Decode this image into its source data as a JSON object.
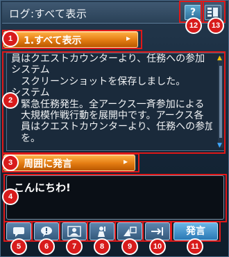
{
  "window": {
    "title": "ログ:すべて表示",
    "help_label": "?"
  },
  "filter_dropdown": {
    "label": "1.すべて表示",
    "arrow": "▸"
  },
  "log": {
    "lines": [
      "員はクエストカウンターより、任務への参加",
      "システム",
      "　スクリーンショットを保存しました。",
      "システム",
      "　緊急任務発生。全アークス一斉参加による",
      "　大規模作戦行動を展開中です。アークス各",
      "　員はクエストカウンターより、任務への参加",
      "　を。"
    ]
  },
  "chat_channel_dropdown": {
    "label": "周囲に発言",
    "arrow": "▸"
  },
  "chat_input": {
    "value": "こんにちわ!"
  },
  "toolbar": {
    "send_label": "発言"
  },
  "markers": [
    "1",
    "2",
    "3",
    "4",
    "5",
    "6",
    "7",
    "8",
    "9",
    "10",
    "11",
    "12",
    "13"
  ],
  "colors": {
    "accent_orange": "#e37b12",
    "marker_red": "#d81b1b",
    "send_blue": "#2a78b4"
  }
}
